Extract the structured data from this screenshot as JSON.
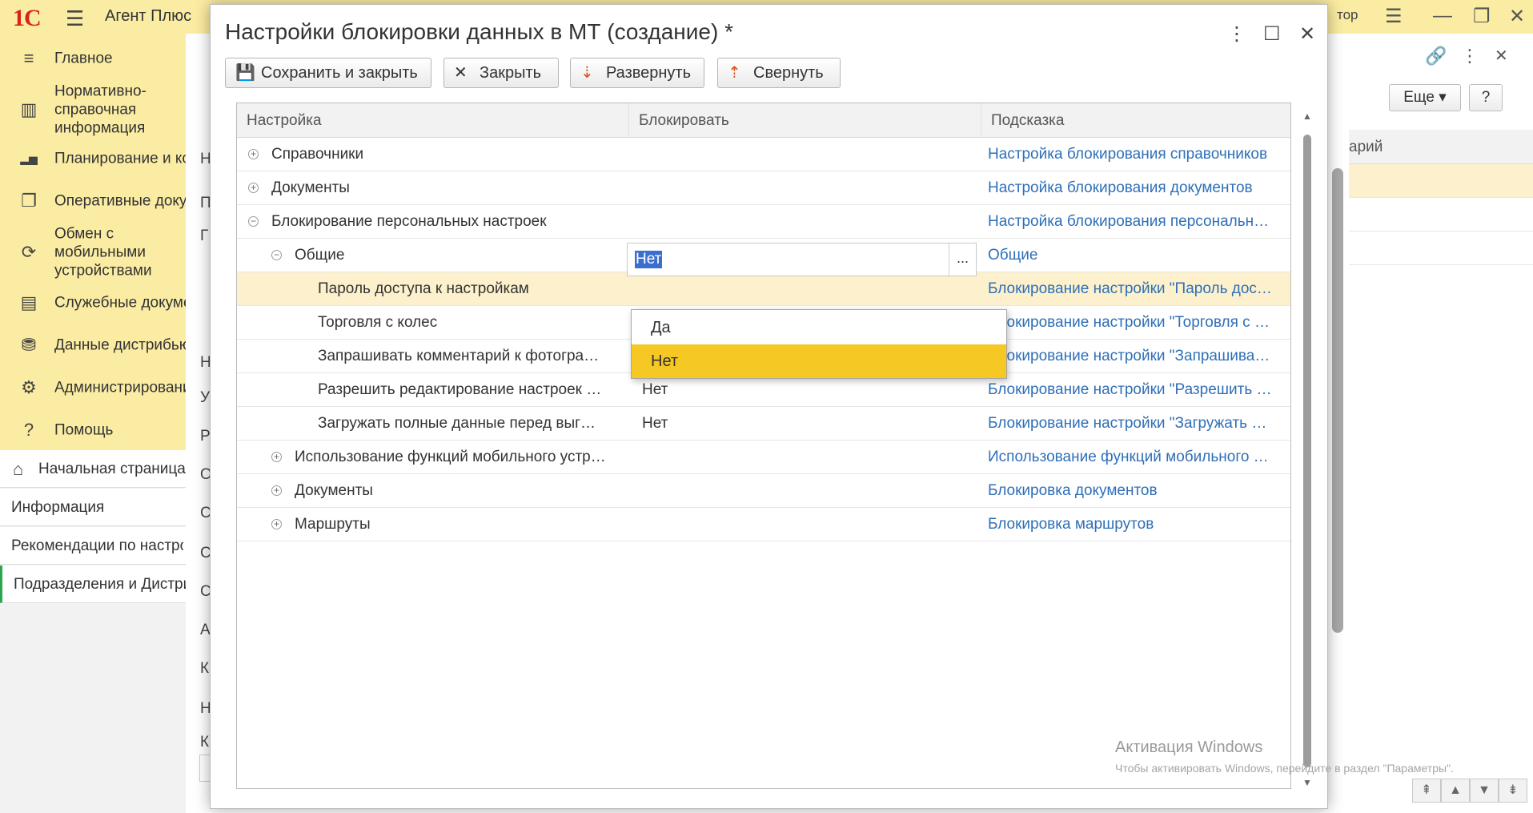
{
  "app": {
    "logo": "1С",
    "title": "Агент Плюс",
    "user": "тор"
  },
  "sidebar": {
    "items": [
      {
        "icon": "menu-lines-icon",
        "glyph": "≡",
        "label": "Главное"
      },
      {
        "icon": "reference-info-icon",
        "glyph": "▥",
        "label": "Нормативно-справочная\nинформация"
      },
      {
        "icon": "chart-icon",
        "glyph": "▂▅",
        "label": "Планирование и контроль"
      },
      {
        "icon": "documents-icon",
        "glyph": "❐",
        "label": "Оперативные документы"
      },
      {
        "icon": "sync-icon",
        "glyph": "⟳",
        "label": "Обмен с мобильными\nустройствами"
      },
      {
        "icon": "service-docs-icon",
        "glyph": "▤",
        "label": "Служебные документы"
      },
      {
        "icon": "distributor-data-icon",
        "glyph": "⛃",
        "label": "Данные дистрибьюторов"
      },
      {
        "icon": "gear-icon",
        "glyph": "⚙",
        "label": "Администрирование"
      },
      {
        "icon": "help-icon",
        "glyph": "?",
        "label": "Помощь"
      }
    ]
  },
  "opened": {
    "items": [
      {
        "label": "Начальная страница",
        "icon": "home-icon",
        "glyph": "⌂"
      },
      {
        "label": "Информация"
      },
      {
        "label": "Рекомендации по настройке"
      },
      {
        "label": "Подразделения и Дистрибьюторы"
      }
    ]
  },
  "bg": {
    "letters": [
      "Н",
      "П",
      "Г",
      "Н",
      "У",
      "Р",
      "О",
      "С",
      "С",
      "С",
      "А",
      "К",
      "Н",
      "К"
    ],
    "more_label": "Еще",
    "help_label": "?",
    "col_header": "арий"
  },
  "dialog": {
    "title": "Настройки блокировки данных в МТ (создание) *",
    "toolbar": {
      "save_close": "Сохранить и закрыть",
      "close": "Закрыть",
      "expand": "Развернуть",
      "collapse": "Свернуть"
    },
    "grid": {
      "headers": {
        "setting": "Настройка",
        "block": "Блокировать",
        "hint": "Подсказка"
      },
      "rows": [
        {
          "level": 0,
          "expander": "+",
          "name": "Справочники",
          "value": "",
          "hint": "Настройка блокирования справочников"
        },
        {
          "level": 0,
          "expander": "+",
          "name": "Документы",
          "value": "",
          "hint": "Настройка блокирования документов"
        },
        {
          "level": 0,
          "expander": "−",
          "name": "Блокирование персональных настроек",
          "value": "",
          "hint": "Настройка блокирования персональн…"
        },
        {
          "level": 1,
          "expander": "−",
          "name": "Общие",
          "value": "",
          "hint": "Общие"
        },
        {
          "level": 2,
          "expander": "",
          "name": "Пароль доступа к настройкам",
          "value": "Нет",
          "hint": "Блокирование настройки \"Пароль дос…"
        },
        {
          "level": 2,
          "expander": "",
          "name": "Торговля с колес",
          "value": "",
          "hint": "Блокирование настройки \"Торговля с …"
        },
        {
          "level": 2,
          "expander": "",
          "name": "Запрашивать комментарий к фотогра…",
          "value": "",
          "hint": "Блокирование настройки \"Запрашива…"
        },
        {
          "level": 2,
          "expander": "",
          "name": "Разрешить редактирование настроек …",
          "value": "Нет",
          "hint": "Блокирование настройки \"Разрешить …"
        },
        {
          "level": 2,
          "expander": "",
          "name": "Загружать полные данные перед выг…",
          "value": "Нет",
          "hint": "Блокирование настройки \"Загружать …"
        },
        {
          "level": 1,
          "expander": "+",
          "name": "Использование функций мобильного устр…",
          "value": "",
          "hint": "Использование функций мобильного …"
        },
        {
          "level": 1,
          "expander": "+",
          "name": "Документы",
          "value": "",
          "hint": "Блокировка документов"
        },
        {
          "level": 1,
          "expander": "+",
          "name": "Маршруты",
          "value": "",
          "hint": "Блокировка маршрутов"
        }
      ],
      "editing_value": "Нет",
      "choice_button": "..."
    },
    "dropdown": {
      "options": [
        "Да",
        "Нет"
      ],
      "selected": "Нет"
    }
  },
  "watermark": {
    "title": "Активация Windows",
    "subtitle": "Чтобы активировать Windows, перейдите в раздел \"Параметры\"."
  },
  "colors": {
    "sidebar_bg": "#fbeca3",
    "hint_link": "#2f6fb7",
    "dropdown_highlight": "#f6c824",
    "selected_row": "#fcf1cc",
    "logo_red": "#d9231a"
  }
}
